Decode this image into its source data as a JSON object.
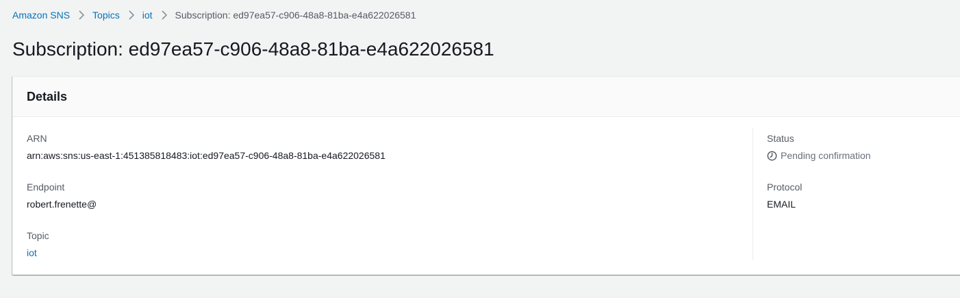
{
  "breadcrumb": {
    "items": [
      {
        "label": "Amazon SNS"
      },
      {
        "label": "Topics"
      },
      {
        "label": "iot"
      }
    ],
    "current": "Subscription: ed97ea57-c906-48a8-81ba-e4a622026581",
    "separator_icon": "chevron-right-icon"
  },
  "page": {
    "title": "Subscription: ed97ea57-c906-48a8-81ba-e4a622026581"
  },
  "details": {
    "title": "Details",
    "arn": {
      "label": "ARN",
      "value": "arn:aws:sns:us-east-1:451385818483:iot:ed97ea57-c906-48a8-81ba-e4a622026581"
    },
    "endpoint": {
      "label": "Endpoint",
      "value": "robert.frenette@"
    },
    "topic": {
      "label": "Topic",
      "value": "iot"
    },
    "status": {
      "label": "Status",
      "value": "Pending confirmation",
      "icon": "clock-icon"
    },
    "protocol": {
      "label": "Protocol",
      "value": "EMAIL"
    }
  },
  "colors": {
    "link": "#0073bb",
    "background": "#f2f3f3",
    "text": "#16191f",
    "label": "#545b64",
    "status_pending": "#687078"
  }
}
